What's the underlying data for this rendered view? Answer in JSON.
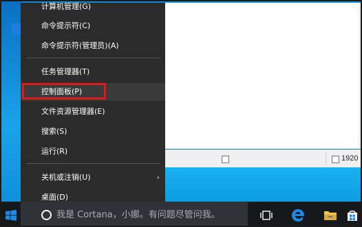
{
  "menu": {
    "items": [
      {
        "label": "计算机管理(G)"
      },
      {
        "label": "命令提示符(C)"
      },
      {
        "label": "命令提示符(管理员)(A)"
      },
      {
        "label": "任务管理器(T)"
      },
      {
        "label": "控制面板(P)"
      },
      {
        "label": "文件资源管理器(E)"
      },
      {
        "label": "搜索(S)"
      },
      {
        "label": "运行(R)"
      },
      {
        "label": "关机或注销(U)"
      },
      {
        "label": "桌面(D)"
      }
    ],
    "submenu_arrow": "›"
  },
  "taskbar": {
    "search_placeholder": "我是 Cortana，小娜。有问题尽管问我。",
    "icons": [
      "task-view-icon",
      "edge-icon",
      "file-explorer-icon",
      "store-icon"
    ]
  },
  "statusbar": {
    "resolution_text": "1920"
  },
  "colors": {
    "menu_bg": "#2b2b2b",
    "highlight_border": "#e01a1a",
    "taskbar_bg": "#16191c",
    "desktop_blue": "#0a8fd6",
    "edge_blue": "#1e88e5",
    "folder_yellow": "#f2c14e"
  }
}
